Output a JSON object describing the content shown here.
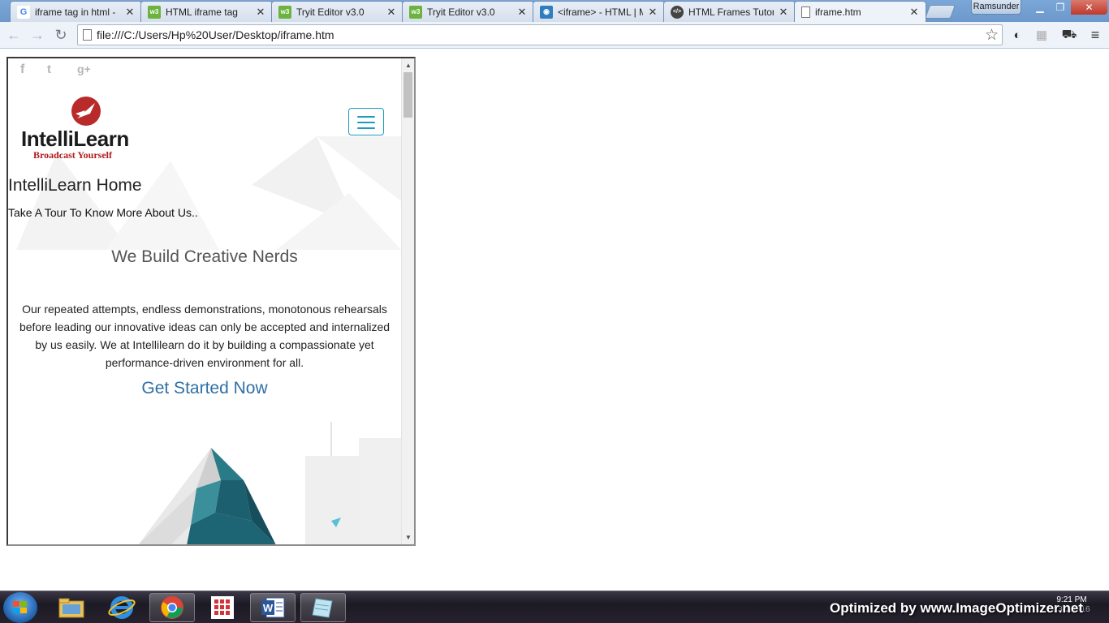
{
  "browser": {
    "tabs": [
      {
        "title": "iframe tag in html -",
        "favicon": "google-icon",
        "color": "#4285f4",
        "glyph": "G"
      },
      {
        "title": "HTML iframe tag",
        "favicon": "w3schools-icon",
        "color": "#6bb33e",
        "glyph": "w3"
      },
      {
        "title": "Tryit Editor v3.0",
        "favicon": "w3schools-icon",
        "color": "#6bb33e",
        "glyph": "w3"
      },
      {
        "title": "Tryit Editor v3.0",
        "favicon": "w3schools-icon",
        "color": "#6bb33e",
        "glyph": "w3"
      },
      {
        "title": "<iframe> - HTML | M",
        "favicon": "mdn-icon",
        "color": "#2f7dbf",
        "glyph": "◉"
      },
      {
        "title": "HTML Frames Tutori",
        "favicon": "code-icon",
        "color": "#444444",
        "glyph": "</>"
      },
      {
        "title": "iframe.htm",
        "favicon": "page-icon",
        "color": "#ffffff",
        "glyph": ""
      }
    ],
    "profile_name": "Ramsunder",
    "address": "file:///C:/Users/Hp%20User/Desktop/iframe.htm"
  },
  "iframe_page": {
    "social_icons": [
      "f",
      "t",
      "g+"
    ],
    "logo_name": "IntelliLearn",
    "logo_tagline": "Broadcast Yourself",
    "heading": "IntelliLearn Home",
    "subheading": "Take A Tour To Know More About Us..",
    "section_title": "We Build Creative Nerds",
    "description": "Our repeated attempts, endless demonstrations, monotonous rehearsals before leading our innovative ideas can only be accepted and internalized by us easily. We at Intellilearn do it by building a compassionate yet performance-driven environment for all.",
    "cta": "Get Started Now"
  },
  "taskbar": {
    "apps": [
      "file-explorer-icon",
      "internet-explorer-icon",
      "chrome-icon",
      "metro-apps-icon",
      "word-icon",
      "notepad-icon"
    ],
    "clock_time": "9:21 PM",
    "clock_date": "13-Jun-16",
    "watermark": "Optimized by www.ImageOptimizer.net"
  },
  "colors": {
    "accent": "#1d9bbf",
    "link": "#2f6fa5",
    "logo_red": "#b21a1a"
  }
}
